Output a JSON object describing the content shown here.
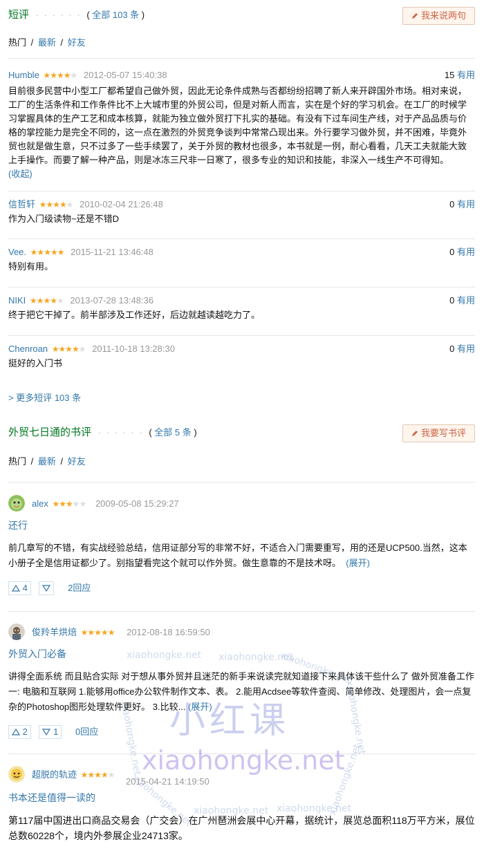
{
  "short": {
    "title": "短评",
    "dots": "· · · · · ·",
    "count_prefix": "( ",
    "count_label": "全部 103 条",
    "count_suffix": " )",
    "write_label": "我来说两句",
    "tabs": [
      "热门",
      "最新",
      "好友"
    ],
    "comments": [
      {
        "user": "Humble",
        "stars": 4,
        "time": "2012-05-07 15:40:38",
        "useful_n": "15",
        "useful_label": "有用",
        "body": "目前很多民营中小型工厂都希望自己做外贸，因此无论条件成熟与否都纷纷招聘了新人来开辟国外市场。相对来说，工厂的生活条件和工作条件比不上大城市里的外贸公司，但是对新人而言，实在是个好的学习机会。在工厂的时候学习掌握具体的生产工艺和成本核算，就能为独立做外贸打下扎实的基础。有没有下过车间生产线，对于产品品质与价格的掌控能力是完全不同的，这一点在激烈的外贸竞争谈判中常常凸现出来。外行要学习做外贸，并不困难，毕竟外贸也就是做生意，只不过多了一些手续罢了，关于外贸的教材也很多，本书就是一例，耐心看看，几天工夫就能大致上手操作。而要了解一种产品，则是冰冻三尺非一日寒了，很多专业的知识和技能，非深入一线生产不可得知。",
        "fold": "(收起)"
      },
      {
        "user": "信哲轩",
        "stars": 4,
        "time": "2010-02-04 21:26:48",
        "useful_n": "0",
        "useful_label": "有用",
        "body": "作为入门级读物~还是不错D"
      },
      {
        "user": "Vee.",
        "stars": 5,
        "time": "2015-11-21 13:46:48",
        "useful_n": "0",
        "useful_label": "有用",
        "body": "特别有用。"
      },
      {
        "user": "NIKI",
        "stars": 4,
        "time": "2013-07-28 13:48:36",
        "useful_n": "0",
        "useful_label": "有用",
        "body": "终于把它干掉了。前半部涉及工作还好，后边就越读越吃力了。"
      },
      {
        "user": "Chenroan",
        "stars": 4,
        "time": "2011-10-18 13:28:30",
        "useful_n": "0",
        "useful_label": "有用",
        "body": "挺好的入门书"
      }
    ],
    "more": "> 更多短评 103 条"
  },
  "reviews": {
    "title": "外贸七日通的书评",
    "dots": "· · · · · ·",
    "count_prefix": "( ",
    "count_label": "全部 5 条",
    "count_suffix": " )",
    "write_label": "我要写书评",
    "tabs": [
      "热门",
      "最新",
      "好友"
    ],
    "items": [
      {
        "user": "alex",
        "stars": 3,
        "time": "2009-05-08 15:29:27",
        "title": "还行",
        "body": "前几章写的不错，有实战经验总结，信用证部分写的非常不好，不适合入门需要重写，用的还是UCP500.当然，这本小册子全是信用证都少了。别指望看完这个就可以作外贸。做生意靠的不是技术呀。",
        "expand": "(展开)",
        "up": "4",
        "down": "",
        "replies": "2回应"
      },
      {
        "user": "俊羚羊烘焙",
        "stars": 5,
        "time": "2012-08-18 16:59:50",
        "title": "外贸入门必备",
        "body": "讲得全面系统 而且贴合实际 对于想从事外贸并且迷茫的新手来说读完就知道接下来具体该干些什么了 做外贸准备工作一: 电脑和互联网 1.能够用office办公软件制作文本、表。 2.能用Acdsee等软件查阅、简单修改、处理图片，会一点复杂的Photoshop图形处理软件更好。 3.比较...",
        "expand": "(展开)",
        "up": "2",
        "down": "1",
        "replies": "0回应"
      },
      {
        "user": "超脱的轨迹",
        "stars": 4,
        "time": "2015-04-21 14:19:50",
        "title": "书本还是值得一读的",
        "body": "第117届中国进出口商品交易会（广交会）在广州琶洲会展中心开幕，据统计，展览总面积118万平方米，展位总数60228个，境内外参展企业24713家。"
      }
    ]
  },
  "watermark": {
    "cn": "小红课",
    "en": "xiaohongke.net",
    "small": "xiaohongke.net"
  },
  "colors": {
    "accent": "#3377aa",
    "section_title": "#007722",
    "star": "#f5a623",
    "button_bg": "#fff5ed",
    "button_text": "#ca6445"
  }
}
